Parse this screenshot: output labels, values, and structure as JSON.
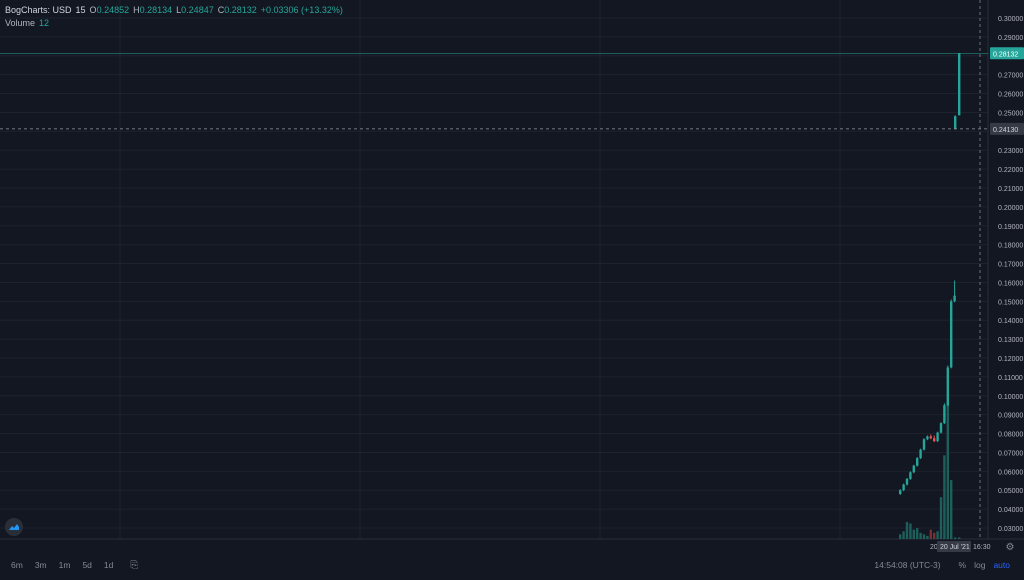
{
  "legend": {
    "symbol": "BogCharts: USD",
    "interval": "15",
    "o_label": "O",
    "o_value": "0.24852",
    "h_label": "H",
    "h_value": "0.28134",
    "l_label": "L",
    "l_value": "0.24847",
    "c_label": "C",
    "c_value": "0.28132",
    "change": "+0.03306 (+13.32%)",
    "volume_label": "Volume",
    "volume_value": "12"
  },
  "colors": {
    "background": "#131722",
    "grid": "#1e222d",
    "up": "#26a69a",
    "down": "#ef5350",
    "text": "#b2b5be"
  },
  "price_axis": {
    "ticks": [
      "0.30000",
      "0.29000",
      "0.28000",
      "0.27000",
      "0.26000",
      "0.25000",
      "0.24000",
      "0.23000",
      "0.22000",
      "0.21000",
      "0.20000",
      "0.19000",
      "0.18000",
      "0.17000",
      "0.16000",
      "0.15000",
      "0.14000",
      "0.13000",
      "0.12000",
      "0.11000",
      "0.10000",
      "0.09000",
      "0.08000",
      "0.07000",
      "0.06000",
      "0.05000",
      "0.04000",
      "0.03000"
    ],
    "last_price_label": "0.28132",
    "crosshair_label": "0.24130"
  },
  "time_axis": {
    "labels": [
      "20",
      "20 Jul '21",
      "16:30"
    ]
  },
  "bottom_bar": {
    "ranges": [
      "6m",
      "3m",
      "1m",
      "5d",
      "1d"
    ],
    "clock": "14:54:08 (UTC-3)",
    "percent_label": "%",
    "log_label": "log",
    "auto_label": "auto"
  },
  "chart_data": {
    "type": "candlestick",
    "ylim": [
      0.025,
      0.305
    ],
    "grid": true,
    "last_price": 0.28132,
    "crosshair_price": 0.2413,
    "candles": [
      {
        "o": 0.048,
        "h": 0.0505,
        "l": 0.0475,
        "c": 0.05
      },
      {
        "o": 0.05,
        "h": 0.0535,
        "l": 0.0495,
        "c": 0.053
      },
      {
        "o": 0.053,
        "h": 0.0565,
        "l": 0.0525,
        "c": 0.056
      },
      {
        "o": 0.056,
        "h": 0.06,
        "l": 0.0555,
        "c": 0.0595
      },
      {
        "o": 0.0595,
        "h": 0.0635,
        "l": 0.059,
        "c": 0.063
      },
      {
        "o": 0.063,
        "h": 0.0675,
        "l": 0.0625,
        "c": 0.067
      },
      {
        "o": 0.067,
        "h": 0.072,
        "l": 0.0665,
        "c": 0.0715
      },
      {
        "o": 0.0715,
        "h": 0.0775,
        "l": 0.071,
        "c": 0.077
      },
      {
        "o": 0.077,
        "h": 0.079,
        "l": 0.0765,
        "c": 0.0785
      },
      {
        "o": 0.0785,
        "h": 0.0795,
        "l": 0.077,
        "c": 0.0775
      },
      {
        "o": 0.0775,
        "h": 0.079,
        "l": 0.0755,
        "c": 0.076
      },
      {
        "o": 0.076,
        "h": 0.081,
        "l": 0.0755,
        "c": 0.0805
      },
      {
        "o": 0.0805,
        "h": 0.086,
        "l": 0.08,
        "c": 0.0855
      },
      {
        "o": 0.0855,
        "h": 0.096,
        "l": 0.085,
        "c": 0.095
      },
      {
        "o": 0.095,
        "h": 0.116,
        "l": 0.0945,
        "c": 0.115
      },
      {
        "o": 0.115,
        "h": 0.151,
        "l": 0.1145,
        "c": 0.15
      },
      {
        "o": 0.15,
        "h": 0.161,
        "l": 0.1495,
        "c": 0.153
      },
      {
        "o": 0.2413,
        "h": 0.2485,
        "l": 0.241,
        "c": 0.248
      },
      {
        "o": 0.2485,
        "h": 0.28134,
        "l": 0.24847,
        "c": 0.28132
      }
    ],
    "volume": [
      3,
      5,
      11,
      10,
      6,
      7,
      4,
      3,
      2,
      6,
      4,
      5,
      27,
      54,
      89,
      38,
      0,
      1,
      1
    ]
  }
}
